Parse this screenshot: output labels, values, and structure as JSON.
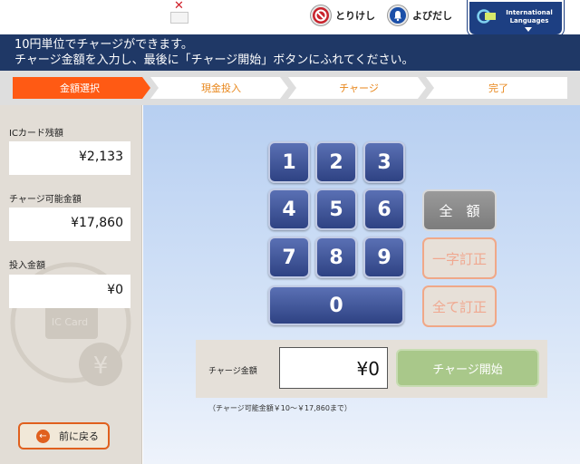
{
  "header": {
    "cancel_label": "とりけし",
    "call_label": "よびだし",
    "language_label": "International Languages"
  },
  "banner": {
    "line1": "10円単位でチャージができます。",
    "line2": "チャージ金額を入力し、最後に「チャージ開始」ボタンにふれてください。"
  },
  "steps": [
    {
      "label": "金額選択",
      "active": true
    },
    {
      "label": "現金投入",
      "active": false
    },
    {
      "label": "チャージ",
      "active": false
    },
    {
      "label": "完了",
      "active": false
    }
  ],
  "left_panel": {
    "balance_label": "ICカード残額",
    "balance_value": "¥2,133",
    "chargeable_label": "チャージ可能金額",
    "chargeable_value": "¥17,860",
    "inserted_label": "投入金額",
    "inserted_value": "¥0",
    "watermark_label": "IC Card",
    "watermark_yen": "¥",
    "back_label": "前に戻る"
  },
  "keypad": {
    "keys": [
      "1",
      "2",
      "3",
      "4",
      "5",
      "6",
      "7",
      "8",
      "9",
      "0"
    ],
    "all_label": "全　額",
    "backspace_label": "一字訂正",
    "clear_label": "全て訂正"
  },
  "amount": {
    "label": "チャージ金額",
    "value": "¥0",
    "start_label": "チャージ開始",
    "range_note": "（チャージ可能金額￥10～￥17,860まで）"
  },
  "colors": {
    "banner": "#1f3866",
    "active_step": "#ff5a14",
    "step_text": "#e8861a",
    "keypad": "#3a4f94",
    "start_button": "#a9c88a",
    "cancel_icon": "#c8232c",
    "call_icon": "#1b4fa8"
  }
}
